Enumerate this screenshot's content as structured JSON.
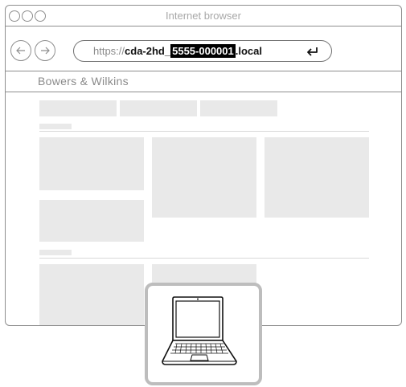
{
  "window": {
    "title": "Internet browser"
  },
  "toolbar": {
    "url_prefix": "https://",
    "url_host": "cda-2hd_",
    "url_highlight": "5555-000001",
    "url_suffix": ".local"
  },
  "site": {
    "brand": "Bowers & Wilkins"
  },
  "icons": {
    "back": "arrow-left-icon",
    "forward": "arrow-right-icon",
    "enter": "return-icon",
    "device": "laptop-icon"
  },
  "colors": {
    "frame": "#8e8e8e",
    "placeholder": "#e9e9e9",
    "highlight_bg": "#000000",
    "card_border": "#bdbdbd"
  }
}
